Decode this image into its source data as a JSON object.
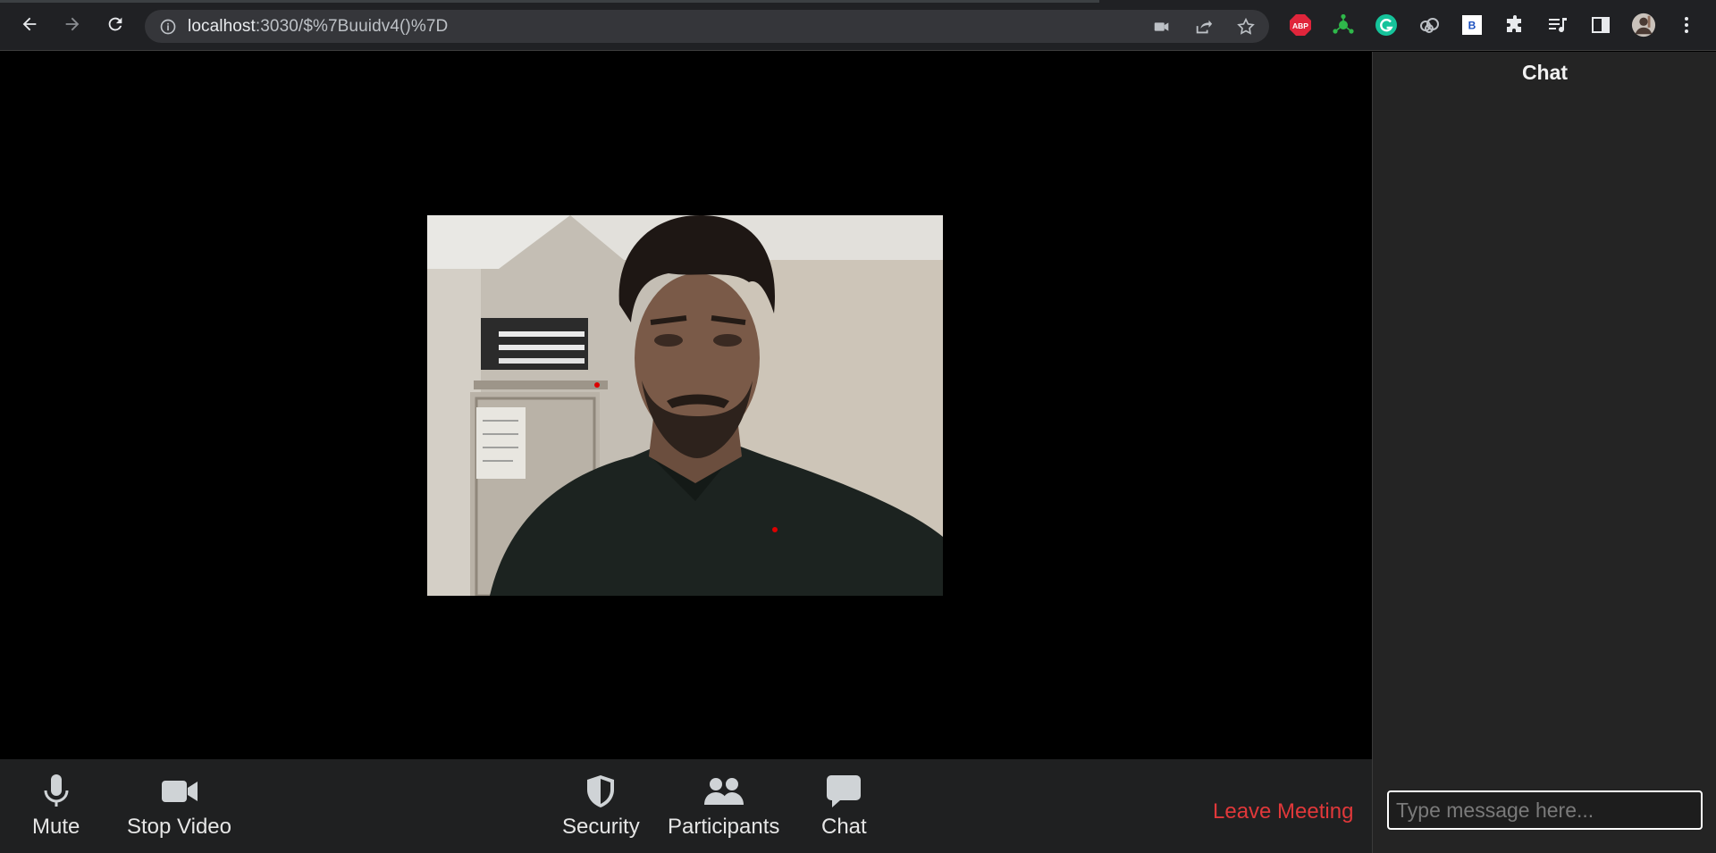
{
  "browser": {
    "url_host": "localhost",
    "url_path": ":3030/$%7Buuidv4()%7D",
    "extension_abp_label": "ABP",
    "extension_b_label": "B"
  },
  "controls": {
    "mute_label": "Mute",
    "stop_video_label": "Stop Video",
    "security_label": "Security",
    "participants_label": "Participants",
    "chat_label": "Chat",
    "leave_label": "Leave Meeting"
  },
  "chat": {
    "title": "Chat",
    "input_placeholder": "Type message here...",
    "input_value": ""
  },
  "colors": {
    "leave_meeting": "#e0383a",
    "chat_bg": "#242424",
    "controls_bg": "#1f2021"
  },
  "icons": {
    "back": "arrow-left-icon",
    "forward": "arrow-right-icon",
    "reload": "reload-icon",
    "mic": "microphone-icon",
    "camera": "video-camera-icon",
    "security": "shield-icon",
    "participants": "people-icon",
    "chat": "chat-bubble-icon"
  }
}
